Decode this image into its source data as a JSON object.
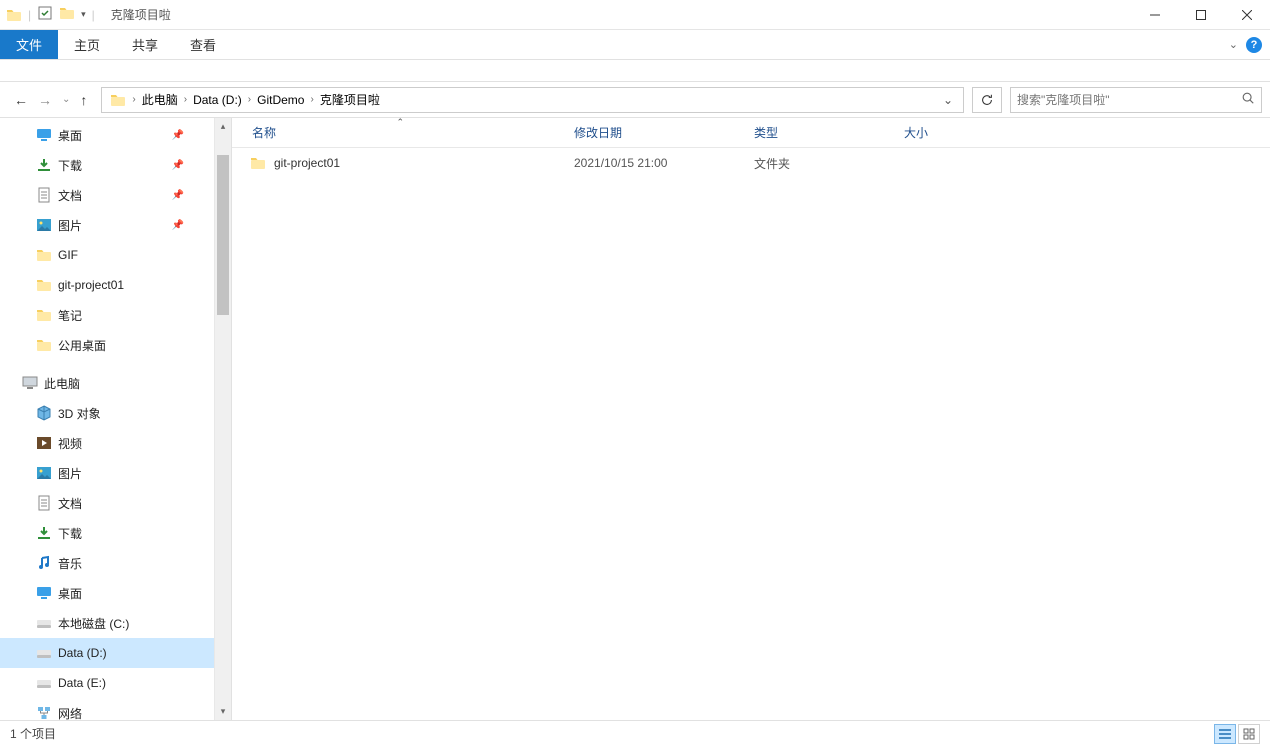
{
  "window": {
    "title": "克隆项目啦"
  },
  "ribbon": {
    "file": "文件",
    "tabs": [
      "主页",
      "共享",
      "查看"
    ]
  },
  "breadcrumb": {
    "segments": [
      "此电脑",
      "Data (D:)",
      "GitDemo",
      "克隆项目啦"
    ]
  },
  "search": {
    "placeholder": "搜索\"克隆项目啦\""
  },
  "sidebar": {
    "quick_access": [
      {
        "label": "桌面",
        "icon": "desktop",
        "pinned": true
      },
      {
        "label": "下载",
        "icon": "downloads",
        "pinned": true
      },
      {
        "label": "文档",
        "icon": "documents",
        "pinned": true
      },
      {
        "label": "图片",
        "icon": "pictures",
        "pinned": true
      },
      {
        "label": "GIF",
        "icon": "folder"
      },
      {
        "label": "git-project01",
        "icon": "folder"
      },
      {
        "label": "笔记",
        "icon": "folder"
      },
      {
        "label": "公用桌面",
        "icon": "folder"
      }
    ],
    "this_pc_label": "此电脑",
    "this_pc": [
      {
        "label": "3D 对象",
        "icon": "3d"
      },
      {
        "label": "视频",
        "icon": "videos"
      },
      {
        "label": "图片",
        "icon": "pictures"
      },
      {
        "label": "文档",
        "icon": "documents"
      },
      {
        "label": "下载",
        "icon": "downloads"
      },
      {
        "label": "音乐",
        "icon": "music"
      },
      {
        "label": "桌面",
        "icon": "desktop"
      },
      {
        "label": "本地磁盘 (C:)",
        "icon": "disk"
      },
      {
        "label": "Data (D:)",
        "icon": "disk",
        "selected": true
      },
      {
        "label": "Data (E:)",
        "icon": "disk"
      },
      {
        "label": "网络",
        "icon": "network"
      }
    ]
  },
  "columns": {
    "name": "名称",
    "date": "修改日期",
    "type": "类型",
    "size": "大小"
  },
  "files": [
    {
      "name": "git-project01",
      "date": "2021/10/15 21:00",
      "type": "文件夹",
      "size": ""
    }
  ],
  "status": {
    "items": "1 个项目"
  }
}
